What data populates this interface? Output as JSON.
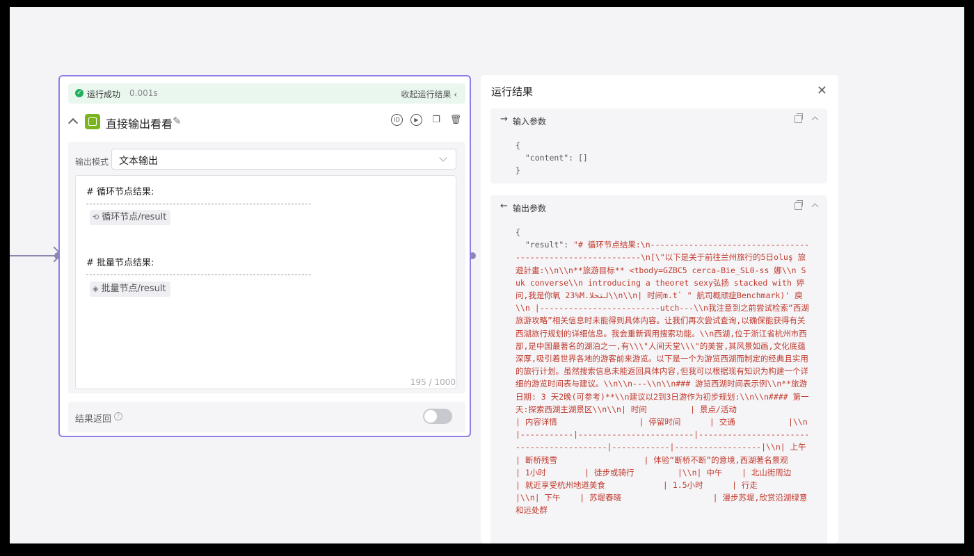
{
  "node": {
    "status": {
      "label": "运行成功",
      "time": "0.001s",
      "collapse": "收起运行结果 ‹"
    },
    "title": "直接输出看看",
    "output_mode": {
      "label": "输出模式",
      "value": "文本输出"
    },
    "editor": {
      "loop_heading": "# 循环节点结果:",
      "loop_var": "循环节点/result",
      "batch_heading": "# 批量节点结果:",
      "batch_var": "批量节点/result",
      "counter": "195 / 1000"
    },
    "result_return": {
      "label": "结果返回",
      "enabled": false
    }
  },
  "panel": {
    "title": "运行结果",
    "input": {
      "title": "输入参数",
      "code": "{\n  \"content\": []\n}"
    },
    "output": {
      "title": "输出参数",
      "open": "{",
      "key": "  \"result\": ",
      "value": "\"# 循环节点结果:\\n-----------------------------------------------------------\\n[\\\"以下是关于前往兰州旅行的5日oluş 旅遊計畫:\\\\n\\\\n**旅游目标** <tbody=GZBC5 cerca-Bie_SL0-ss 娜\\\\n Suk converse\\\\n introducing a theoret sexy弘扬 stacked with 婷问,我是你氧 23%M.لتحلا\\\\n\\\\n| 时间m.t` \" 航司概顽症Benchmark)' 庾\\\\n |-------------------------utch---\\\\n我注意到之前尝试检索“西湖旅游攻略”相关信息时未能得到具体内容。让我们再次尝试查询,以确保能获得有关西湖旅行规划的详细信息。我会重新调用搜索功能。\\\\n西湖,位于浙江省杭州市西部,是中国最著名的湖泊之一,有\\\\\\\"人间天堂\\\\\\\"的美誉,其风景如画,文化底蕴深厚,吸引着世界各地的游客前来游览。以下是一个为游览西湖而制定的经典且实用的旅行计划。虽然搜索信息未能返回具体内容,但我可以根据现有知识为构建一个详细的游览时间表与建议。\\\\n\\\\n---\\\\n\\\\n### 游览西湖时间表示例\\\\n**旅游日期: 3 天2晚(可参考)**\\\\n建议以2到3日游作为初步规划:\\\\n\\\\n#### 第一天:探索西湖主湖景区\\\\n\\\\n| 时间         | 景点/活动                | 内容详情                 | 停留时间      | 交通           |\\\\n|-----------|------------------------|------------------------------------------|------------|------------------|\\\\n| 上午        | 断桥残雪                  | 体验“断桥不断”的意境,西湖著名景观          | 1小时        | 徒步或骑行         |\\\\n| 中午    | 北山街周边                   | 就近享受杭州地道美食            | 1.5小时      | 行走             |\\\\n| 下午    | 苏堤春晓                   | 漫步苏堤,欣赏沿湖绿意和远处群"
    }
  },
  "colors": {
    "accent": "#8b7ee8",
    "success": "#22b05e",
    "node_icon": "#7ab51d",
    "result_text": "#c0392b"
  }
}
